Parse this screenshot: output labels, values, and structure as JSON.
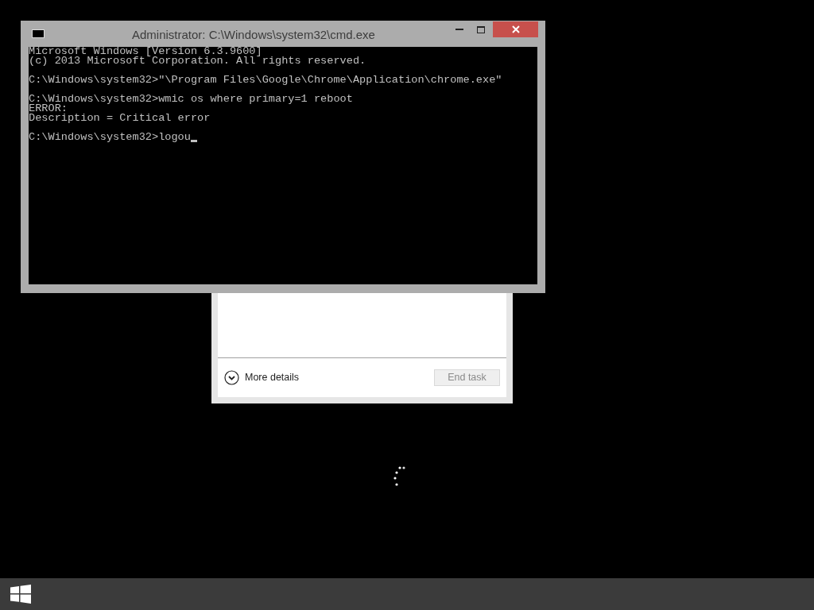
{
  "console_window": {
    "title": "Administrator: C:\\Windows\\system32\\cmd.exe",
    "blocks": [
      [
        "Microsoft Windows [Version 6.3.9600]",
        "(c) 2013 Microsoft Corporation. All rights reserved."
      ],
      [
        "C:\\Windows\\system32>\"\\Program Files\\Google\\Chrome\\Application\\chrome.exe\""
      ],
      [
        "C:\\Windows\\system32>wmic os where primary=1 reboot",
        "ERROR:",
        "Description = Critical error"
      ],
      [
        "C:\\Windows\\system32>logou"
      ]
    ],
    "cursor": true
  },
  "task_dialog": {
    "details_link": "More details",
    "end_task_button": {
      "label": "End task",
      "disabled": true
    }
  }
}
